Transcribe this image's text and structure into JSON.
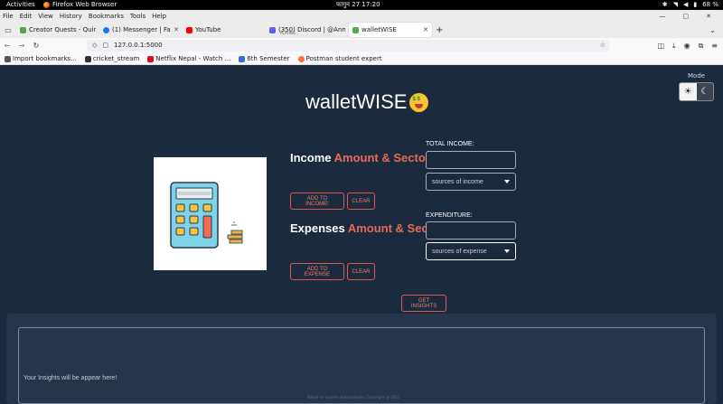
{
  "os_bar": {
    "activities": "Activities",
    "app_name": "Firefox Web Browser",
    "clock": "फागुन 27  17:20",
    "battery": "68 %"
  },
  "menu": [
    "File",
    "Edit",
    "View",
    "History",
    "Bookmarks",
    "Tools",
    "Help"
  ],
  "tabs": [
    {
      "label": "Creator Quests - Quine",
      "color": "#59a34a",
      "active": false
    },
    {
      "label": "(1) Messenger | Facebook",
      "color": "#1877f2",
      "active": false
    },
    {
      "label": "YouTube",
      "color": "#ff0000",
      "active": false
    },
    {
      "label": "(350) Discord | @Anmol",
      "color": "#5865f2",
      "active": false,
      "sub": "PLAYING"
    },
    {
      "label": "walletWISE",
      "color": "#4caf50",
      "active": true
    }
  ],
  "url": "127.0.0.1:5000",
  "bookmarks": [
    {
      "label": "Import bookmarks...",
      "color": "#555"
    },
    {
      "label": "cricket_stream",
      "color": "#333"
    },
    {
      "label": "Netflix Nepal - Watch ...",
      "color": "#e50914"
    },
    {
      "label": "6th Semester",
      "color": "#2f6fd6"
    },
    {
      "label": "Postman student expert",
      "color": "#ff6c37"
    }
  ],
  "page": {
    "mode_label": "Mode",
    "title": "walletWISE",
    "income": {
      "heading_word": "Income",
      "heading_accent": "Amount & Sector",
      "heading_end": "!",
      "add_label": "ADD TO INCOME!",
      "clear_label": "CLEAR",
      "field_label": "TOTAL INCOME:",
      "select_value": "sources of income"
    },
    "expense": {
      "heading_word": "Expenses",
      "heading_accent": "Amount & Sector",
      "heading_end": "!",
      "add_label": "ADD TO EXPENSE",
      "clear_label": "CLEAR",
      "field_label": "EXPENDITURE:",
      "select_value": "sources of expense"
    },
    "insights_button": "GET INSIGHTS",
    "insights_placeholder": "Your Insights will be appear here!",
    "footer": "Based on income and expenses. Copyright @ 2023"
  },
  "colors": {
    "page_bg": "#1c2a3e",
    "accent": "#e46a55"
  }
}
